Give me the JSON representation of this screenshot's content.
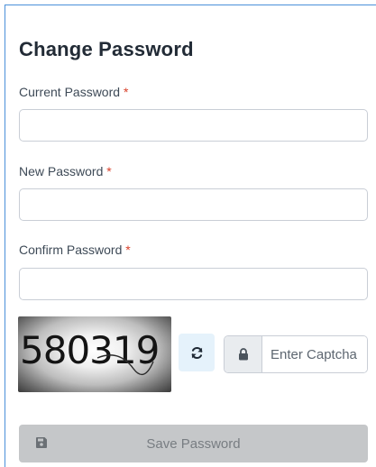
{
  "form": {
    "title": "Change Password",
    "required_marker": "*",
    "current_password": {
      "label": "Current Password",
      "value": ""
    },
    "new_password": {
      "label": "New Password",
      "value": ""
    },
    "confirm_password": {
      "label": "Confirm Password",
      "value": ""
    },
    "captcha": {
      "image_text": "580319",
      "refresh_icon": "refresh-icon",
      "lock_icon": "lock-icon",
      "placeholder": "Enter Captcha",
      "value": ""
    },
    "save_button": {
      "label": "Save Password",
      "icon": "save-icon"
    }
  },
  "colors": {
    "accent_border": "#4a90d9",
    "required": "#d9412b",
    "refresh_bg": "#e5f2fb",
    "disabled_button": "#c5c7c9"
  }
}
